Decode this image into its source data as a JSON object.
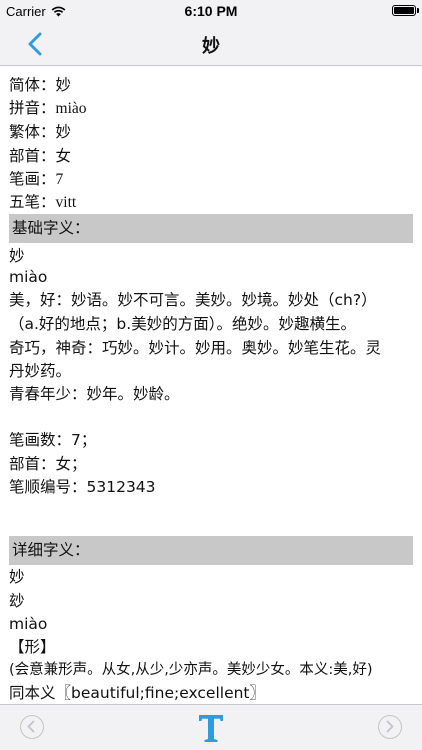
{
  "status_bar": {
    "carrier": "Carrier",
    "time": "6:10 PM"
  },
  "nav": {
    "title": "妙"
  },
  "basic_info": [
    {
      "label": "简体：",
      "value": "妙"
    },
    {
      "label": "拼音：",
      "value": "miào"
    },
    {
      "label": "繁体：",
      "value": "妙"
    },
    {
      "label": "部首：",
      "value": "女"
    },
    {
      "label": "笔画：",
      "value": "7"
    },
    {
      "label": "五笔：",
      "value": "vitt"
    }
  ],
  "basic_meaning": {
    "header": "基础字义：",
    "lines": [
      "妙",
      "miào",
      "美，好：妙语。妙不可言。美妙。妙境。妙处（ch?）",
      "（a.好的地点；b.美妙的方面）。绝妙。妙趣横生。",
      "奇巧，神奇：巧妙。妙计。妙用。奥妙。妙笔生花。灵",
      "丹妙药。",
      "青春年少：妙年。妙龄。",
      "笔画数：7；",
      "部首：女；",
      "笔顺编号：5312343"
    ]
  },
  "detail_meaning": {
    "header": "详细字义：",
    "lines": [
      "妙",
      "玅",
      "miào",
      "【形】",
      "(会意兼形声。从女,从少,少亦声。美妙少女。本义:美,好)",
      "同本义〖beautiful;fine;excellent〗"
    ]
  },
  "toolbar": {
    "font_label": "T"
  },
  "colors": {
    "accent": "#2f9be0",
    "header_bg": "#c8c8c8",
    "bar_bg": "#f2f2f4"
  }
}
